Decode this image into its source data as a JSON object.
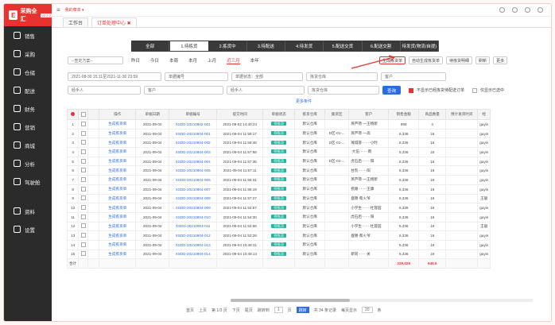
{
  "app": {
    "logo_text": "采购全汇",
    "logo_badge": "V2.2.2",
    "top_crumb": "我的菜单 ▾"
  },
  "sidebar": {
    "items": [
      {
        "label": "销售"
      },
      {
        "label": "采购"
      },
      {
        "label": "仓储"
      },
      {
        "label": "配送"
      },
      {
        "label": "财务"
      },
      {
        "label": "营销"
      },
      {
        "label": "商城"
      },
      {
        "label": "分析"
      },
      {
        "label": "驾驶舱"
      }
    ],
    "bottom": [
      {
        "label": "资料"
      },
      {
        "label": "设置"
      }
    ]
  },
  "tabs": [
    {
      "label": "工作台"
    },
    {
      "label": "订单处理中心 ✖"
    }
  ],
  "status_tabs": [
    "全部",
    "1.待拣货",
    "2.拣货中",
    "3.待配送",
    "4.待发货",
    "5.配送交货",
    "6.配送交割",
    "待发货(物流/自提)"
  ],
  "filters": {
    "scheme": "--查定方案--",
    "periods": [
      "昨日",
      "今日",
      "本周",
      "本月",
      "上月",
      "近三月",
      "本年"
    ],
    "actions": [
      "生成拣货单",
      "自动生成拣货单",
      "待拣货明细",
      "刷新",
      "更多"
    ],
    "date_range": "2021-08-30 15:11至2021-11-30 23:59",
    "order_no": "单据编号",
    "order_status": "单据状态：全部",
    "warehouse_ph": "拣货仓库",
    "customer_ph": "客户",
    "handler": "经手人",
    "client": "客户",
    "handler2": "经手人",
    "pick_warehouse": "拣货仓库",
    "search": "查询",
    "opt1": "不显示已经拣货待配送订单",
    "opt2": "仅显示已选中",
    "more_cond": "更多条件"
  },
  "table": {
    "headers": [
      "",
      "",
      "",
      "操作",
      "单据日期",
      "单据编号",
      "提交时间",
      "单据状态",
      "拣货仓库",
      "集货区",
      "客户",
      "销售金额",
      "商品数量",
      "预计发货时间",
      "经"
    ],
    "rows": [
      [
        "1",
        "生成拣货单",
        "2021-09-02",
        "XSDD-20210902-001",
        "2021-09-02 14:40:24",
        "待拣货",
        "默认仓库",
        "",
        "蒸芦荷·一王杨新",
        "996",
        "4",
        "",
        "guyin"
      ],
      [
        "2",
        "生成拣货单",
        "2021-09-04",
        "XSDD-20210904-001",
        "2021-09-04 11:59:17",
        "待拣货",
        "默认仓库",
        "D区-01-...",
        "蒸芦荷·一高",
        "6,336",
        "16",
        "",
        "guyin"
      ],
      [
        "3",
        "生成拣货单",
        "2021-09-04",
        "XSDD-20210904-002",
        "2021-09-04 11:58:48",
        "待拣货",
        "默认仓库",
        "D区-01-...",
        "潍城蓉·······小时",
        "6,336",
        "16",
        "",
        "guyin"
      ],
      [
        "4",
        "生成拣货单",
        "2021-09-04",
        "XSDD-20210904-003",
        "2021-09-04 11:57:58",
        "待拣货",
        "默认仓库",
        "",
        "·大伍·······雨",
        "6,336",
        "16",
        "",
        "guyin"
      ],
      [
        "5",
        "生成拣货单",
        "2021-09-04",
        "XSDD-20210904-004",
        "2021-09-04 11:57:35",
        "待拣货",
        "默认仓库",
        "D区-01-...",
        "虎石启·······阳",
        "6,336",
        "16",
        "",
        "guyin"
      ],
      [
        "6",
        "生成拣货单",
        "2021-09-04",
        "XSDD-20210904-005",
        "2021-09-04 11:57:11",
        "待拣货",
        "默认仓库",
        "",
        "甘凯·······阳",
        "6,336",
        "16",
        "",
        "guyin"
      ],
      [
        "7",
        "生成拣货单",
        "2021-09-04",
        "XSDD-20210904-006",
        "2021-09-04 11:56:31",
        "待拣货",
        "默认仓库",
        "",
        "蒸芦荷·一王杨新",
        "6,336",
        "16",
        "",
        "guyin"
      ],
      [
        "8",
        "生成拣货单",
        "2021-09-04",
        "XSDD-20210904-007",
        "2021-09-04 11:56:19",
        "待拣货",
        "默认仓库",
        "",
        "抚顺·······王康",
        "6,336",
        "16",
        "",
        "guyin"
      ],
      [
        "9",
        "生成拣货单",
        "2021-09-04",
        "XSDD-20210904-008",
        "2021-09-04 11:57:27",
        "待拣货",
        "默认仓库",
        "",
        "盘锦·蔡火爷",
        "6,336",
        "16",
        "",
        "王聪"
      ],
      [
        "10",
        "生成拣货单",
        "2021-09-04",
        "XSDD-20210904-009",
        "2021-09-04 11:54:57",
        "待拣货",
        "默认仓库",
        "",
        "小学生·······杜蓉园",
        "6,336",
        "16",
        "",
        "guyin"
      ],
      [
        "11",
        "生成拣货单",
        "2021-09-04",
        "XSDD-20210904-010",
        "2021-09-04 11:54:30",
        "待拣货",
        "默认仓库",
        "",
        "虎石启·······阳",
        "6,336",
        "16",
        "",
        "guyin"
      ],
      [
        "12",
        "生成拣货单",
        "2021-09-04",
        "XSDD-20210904-011",
        "2021-09-04 11:53:58",
        "待拣货",
        "默认仓库",
        "",
        "小学生·······杜蓉园",
        "6,336",
        "16",
        "",
        "王聪"
      ],
      [
        "13",
        "生成拣货单",
        "2021-09-04",
        "XSDD-20210904-012",
        "2021-09-04 11:53:28",
        "待拣货",
        "默认仓库",
        "",
        "盘锦·蔡火爷",
        "6,336",
        "16",
        "",
        "guyin"
      ],
      [
        "14",
        "生成拣货单",
        "2021-09-04",
        "XSDD-20210904-013",
        "2021-09-04 10:48:31",
        "待拣货",
        "默认仓库",
        "",
        "",
        "6,336",
        "16",
        "",
        "guyin"
      ],
      [
        "15",
        "生成拣货单",
        "2021-09-04",
        "XSDD-20210904-014",
        "2021-09-04 10:48:14",
        "待拣货",
        "默认仓库",
        "",
        "新同·······关",
        "6,336",
        "16",
        "",
        "guyin"
      ]
    ],
    "total": {
      "label": "合计",
      "amount": "229,029",
      "qty": "646.5"
    }
  },
  "pager": {
    "first": "首页",
    "prev": "上页",
    "info": "第 1/3 页",
    "next": "下页",
    "last": "尾页",
    "goto_pre": "跳转到",
    "goto_val": "1",
    "goto_post": "页",
    "go": "跳转",
    "total": "共 34 条记录",
    "per_pre": "每页显示",
    "per_val": "20",
    "per_post": "条"
  },
  "colors": {
    "accent": "#e8322f",
    "sidebar": "#2b2b2b",
    "status": "#23b5a0",
    "link": "#2d6be4"
  }
}
